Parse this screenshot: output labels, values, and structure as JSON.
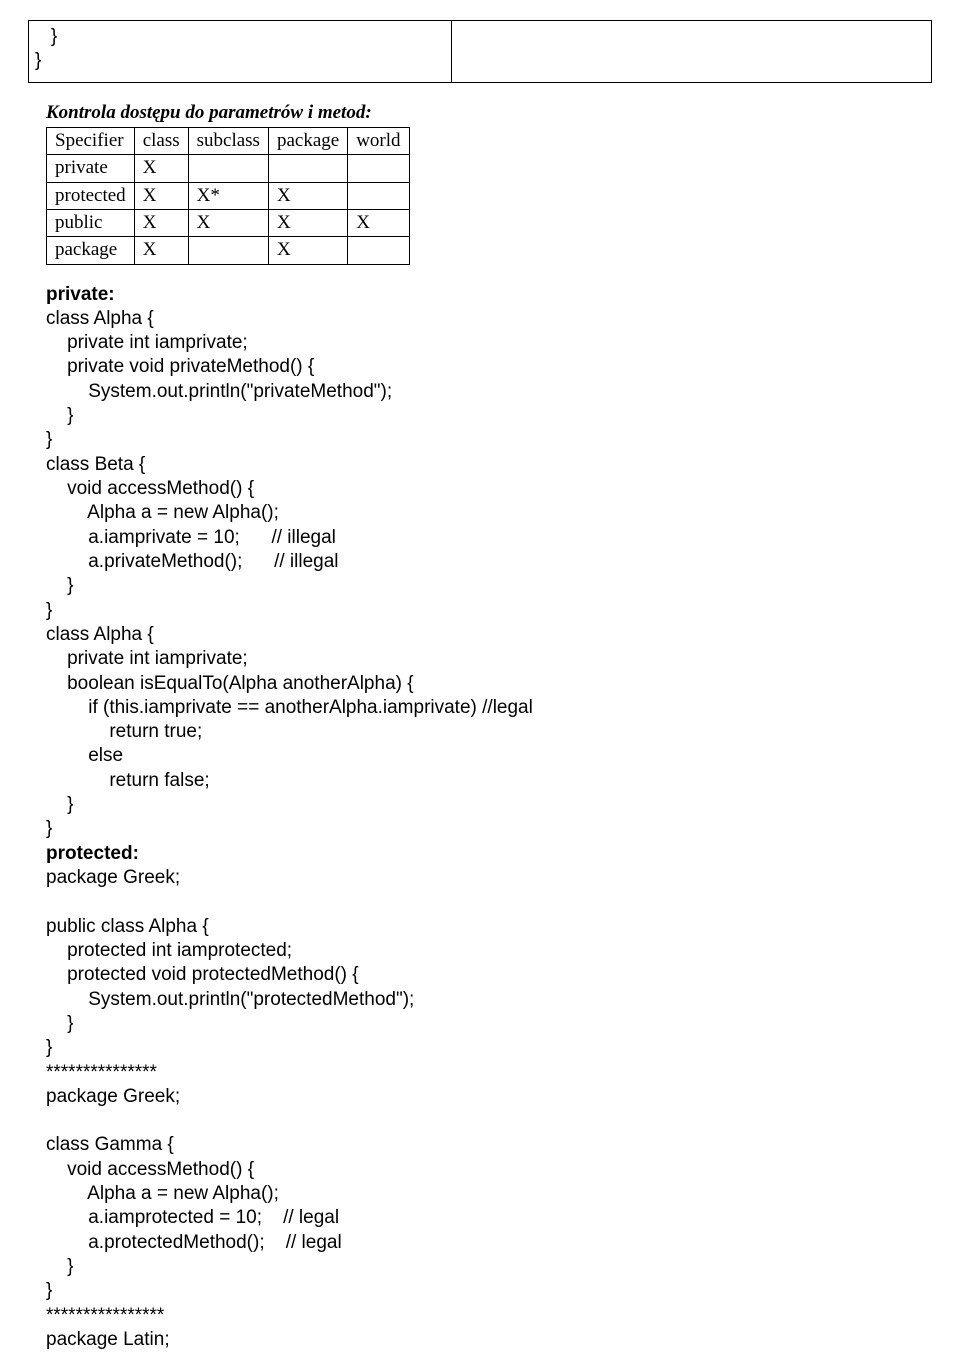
{
  "topBox": {
    "line1": "   }",
    "line2": "}"
  },
  "heading": "Kontrola dostępu do parametrów i metod:",
  "table": {
    "headers": [
      "Specifier",
      "class",
      "subclass",
      "package",
      "world"
    ],
    "rows": [
      [
        "private",
        "X",
        "",
        "",
        ""
      ],
      [
        "protected",
        "X",
        "X*",
        "X",
        ""
      ],
      [
        "public",
        "X",
        "X",
        "X",
        "X"
      ],
      [
        "package",
        "X",
        "",
        "X",
        ""
      ]
    ]
  },
  "labels": {
    "private": "private:",
    "protected": "protected:"
  },
  "code": {
    "block1": "class Alpha {\n    private int iamprivate;\n    private void privateMethod() {\n        System.out.println(\"privateMethod\");\n    }\n}\nclass Beta {\n    void accessMethod() {\n        Alpha a = new Alpha();\n        a.iamprivate = 10;      // illegal\n        a.privateMethod();      // illegal\n    }\n}\nclass Alpha {\n    private int iamprivate;\n    boolean isEqualTo(Alpha anotherAlpha) {\n        if (this.iamprivate == anotherAlpha.iamprivate) //legal\n            return true;\n        else\n            return false;\n    }\n}",
    "block2": "package Greek;\n\npublic class Alpha {\n    protected int iamprotected;\n    protected void protectedMethod() {\n        System.out.println(\"protectedMethod\");\n    }\n}\n***************\npackage Greek;\n\nclass Gamma {\n    void accessMethod() {\n        Alpha a = new Alpha();\n        a.iamprotected = 10;    // legal\n        a.protectedMethod();    // legal\n    }\n}\n****************\npackage Latin;"
  }
}
